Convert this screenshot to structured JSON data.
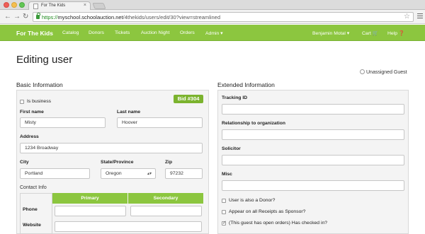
{
  "browser": {
    "tab_title": "For The Kids",
    "tab_close": "×",
    "url_https": "https://",
    "url_host": "myschool.schoolauction.net",
    "url_path": "/4thekids/users/edit/30?view=streamlined",
    "back_glyph": "←",
    "forward_glyph": "→",
    "reload_glyph": "↻",
    "star_glyph": "☆"
  },
  "nav": {
    "brand": "For The Kids",
    "items": [
      "Catalog",
      "Donors",
      "Tickets",
      "Auction Night",
      "Orders",
      "Admin ▾"
    ],
    "user": "Benjamin Motal ▾",
    "cart": "Cart 🛒",
    "help": "Help ❓"
  },
  "page": {
    "title": "Editing user",
    "unassigned_guest": "Unassigned Guest"
  },
  "basic": {
    "heading": "Basic Information",
    "bid_badge": "Bid #304",
    "is_business": "Is business",
    "first_name_label": "First name",
    "first_name": "Misty",
    "last_name_label": "Last name",
    "last_name": "Hoover",
    "address_label": "Address",
    "address": "1234 Broadway",
    "city_label": "City",
    "city": "Portland",
    "state_label": "State/Province",
    "state": "Oregon",
    "zip_label": "Zip",
    "zip": "97232",
    "contact_info": "Contact Info",
    "col_primary": "Primary",
    "col_secondary": "Secondary",
    "row_phone": "Phone",
    "row_website": "Website"
  },
  "extended": {
    "heading": "Extended Information",
    "tracking_id": "Tracking ID",
    "relationship": "Relationship to organization",
    "solicitor": "Solicitor",
    "misc": "Misc",
    "also_donor": "User is also a Donor?",
    "receipts_sponsor": "Appear on all Receipts as Sponsor?",
    "checked_in": "(This guest has open orders) Has checked in?"
  },
  "colors": {
    "accent_green": "#8cc63f",
    "badge_green": "#7bb32e"
  }
}
